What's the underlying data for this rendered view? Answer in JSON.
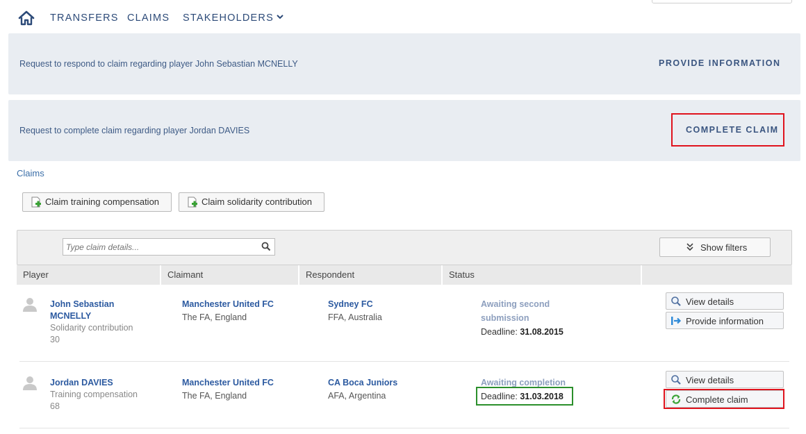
{
  "nav": {
    "home_icon": "home-icon",
    "items": [
      "TRANSFERS",
      "CLAIMS",
      "STAKEHOLDERS"
    ]
  },
  "notices": [
    {
      "text": "Request to respond to claim regarding player John Sebastian MCNELLY",
      "action": "PROVIDE INFORMATION"
    },
    {
      "text": "Request to complete claim regarding player Jordan DAVIES",
      "action": "COMPLETE CLAIM"
    }
  ],
  "breadcrumb": "Claims",
  "actions": {
    "claim_training": "Claim training compensation",
    "claim_solidarity": "Claim solidarity contribution"
  },
  "search": {
    "placeholder": "Type claim details..."
  },
  "filters_label": "Show filters",
  "columns": [
    "Player",
    "Claimant",
    "Respondent",
    "Status"
  ],
  "rows": [
    {
      "player_first": "John Sebastian",
      "player_last": "MCNELLY",
      "claim_type": "Solidarity contribution",
      "claim_no": "30",
      "claimant": "Manchester United FC",
      "claimant_assoc": "The FA, England",
      "respondent": "Sydney FC",
      "respondent_assoc": "FFA, Australia",
      "status_line1": "Awaiting second",
      "status_line2": "submission",
      "deadline_label": "Deadline:",
      "deadline_value": "31.08.2015",
      "btn_view": "View details",
      "btn_action": "Provide information"
    },
    {
      "player_name": "Jordan DAVIES",
      "claim_type": "Training compensation",
      "claim_no": "68",
      "claimant": "Manchester United FC",
      "claimant_assoc": "The FA, England",
      "respondent": "CA Boca Juniors",
      "respondent_assoc": "AFA, Argentina",
      "status_line1": "Awaiting completion",
      "deadline_label": "Deadline:",
      "deadline_value": "31.03.2018",
      "btn_view": "View details",
      "btn_action": "Complete claim"
    }
  ],
  "colors": {
    "nav_text": "#2c4a78",
    "notice_bg": "#e9edf2",
    "link": "#2c5aa0",
    "highlight_red": "#e0131d",
    "highlight_green": "#2b8f2b"
  }
}
